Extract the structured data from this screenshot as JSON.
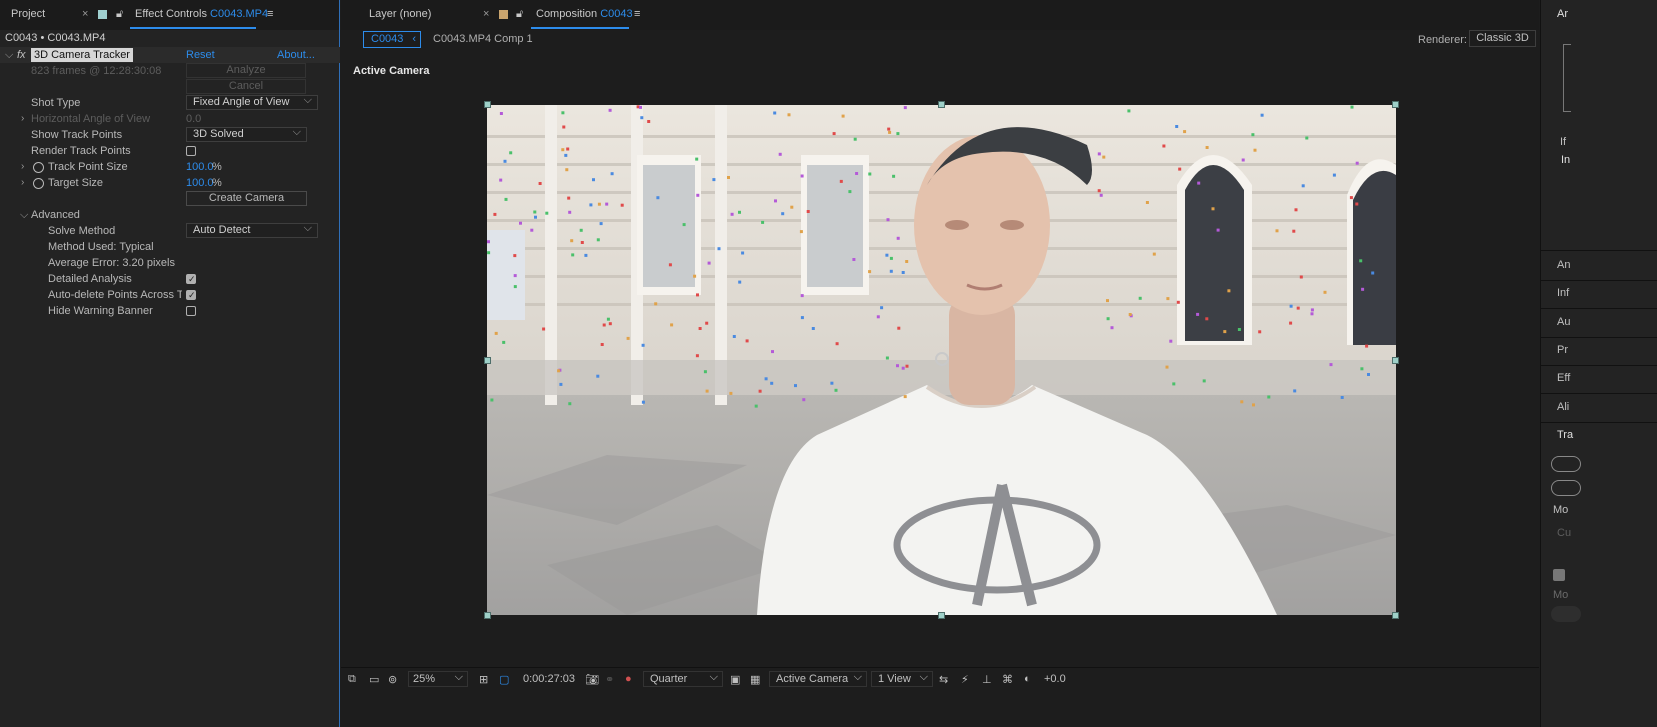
{
  "left_panel": {
    "tabs": {
      "project": "Project",
      "effect_controls": "Effect Controls",
      "effect_controls_file": "C0043.MP4"
    },
    "breadcrumb": "C0043 • C0043.MP4",
    "effect": {
      "name": "3D Camera Tracker",
      "reset": "Reset",
      "about": "About..."
    },
    "frames_info": "823 frames @ 12:28:30:08",
    "analyze": "Analyze",
    "cancel": "Cancel",
    "shot_type": {
      "label": "Shot Type",
      "value": "Fixed Angle of View"
    },
    "haov": {
      "label": "Horizontal Angle of View",
      "value": "0.0"
    },
    "show_track_points": {
      "label": "Show Track Points",
      "value": "3D Solved"
    },
    "render_track_points": {
      "label": "Render Track Points",
      "checked": false
    },
    "track_point_size": {
      "label": "Track Point Size",
      "value": "100.0",
      "unit": "%"
    },
    "target_size": {
      "label": "Target Size",
      "value": "100.0",
      "unit": "%"
    },
    "create_camera": "Create Camera",
    "advanced": {
      "label": "Advanced"
    },
    "solve_method": {
      "label": "Solve Method",
      "value": "Auto Detect"
    },
    "method_used": "Method Used: Typical",
    "average_error": "Average Error: 3.20 pixels",
    "detailed_analysis": {
      "label": "Detailed Analysis",
      "checked": true
    },
    "auto_delete": {
      "label": "Auto-delete Points Across Ti",
      "checked": true
    },
    "hide_warning": {
      "label": "Hide Warning Banner",
      "checked": false
    }
  },
  "composition": {
    "layer_tab": "Layer (none)",
    "comp_tab": "Composition",
    "comp_tab_name": "C0043",
    "breadcrumb_active": "C0043",
    "breadcrumb_next": "C0043.MP4 Comp 1",
    "renderer_label": "Renderer:",
    "renderer_value": "Classic 3D",
    "active_camera_label": "Active Camera"
  },
  "viewer_toolbar": {
    "zoom": "25%",
    "timecode": "0:00:27:03",
    "resolution": "Quarter",
    "camera": "Active Camera",
    "views": "1 View",
    "exposure": "+0.0"
  },
  "right_panel": {
    "items": [
      "Ar",
      "If",
      "In",
      "An",
      "Inf",
      "Au",
      "Pr",
      "Eff",
      "Ali",
      "Tra",
      "Mo",
      "Cu",
      "Mo"
    ]
  },
  "colors": {
    "accent": "#2d8ceb",
    "panel": "#232323",
    "background": "#1d1d1d"
  }
}
